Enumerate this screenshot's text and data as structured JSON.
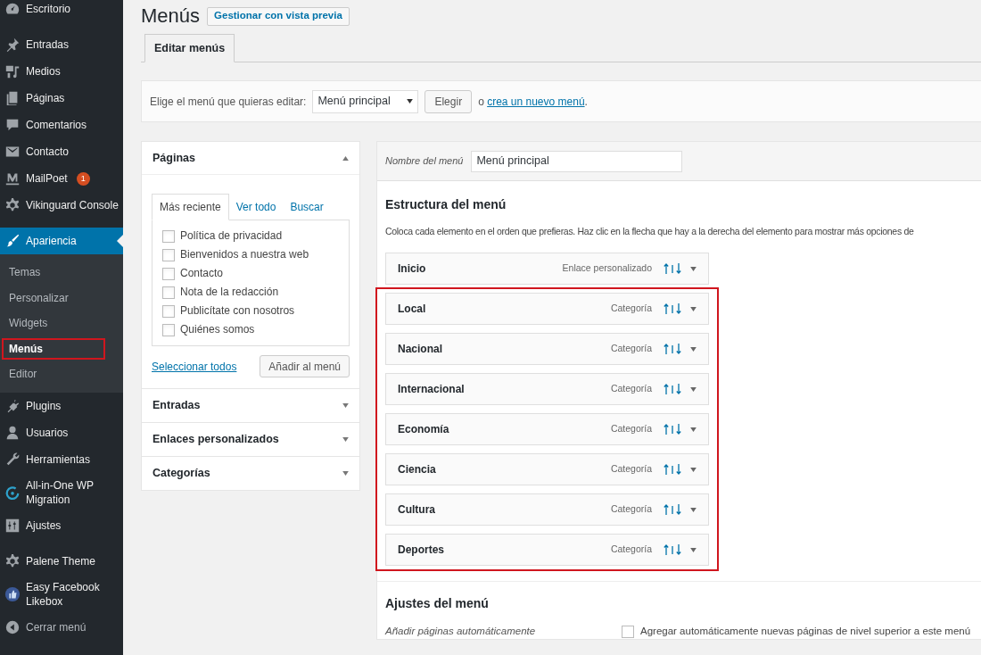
{
  "sidebar": {
    "groups": [
      [
        {
          "label": "Escritorio",
          "selected": false
        }
      ],
      [
        {
          "label": "Entradas",
          "selected": false
        },
        {
          "label": "Medios",
          "selected": false
        },
        {
          "label": "Páginas",
          "selected": false
        },
        {
          "label": "Comentarios",
          "selected": false
        },
        {
          "label": "Contacto",
          "selected": false
        },
        {
          "label": "MailPoet",
          "badge": "1",
          "selected": false
        },
        {
          "label": "Vikinguard Console",
          "selected": false
        }
      ],
      [
        {
          "label": "Apariencia",
          "selected": true,
          "children": [
            {
              "label": "Temas",
              "selected": false
            },
            {
              "label": "Personalizar",
              "selected": false
            },
            {
              "label": "Widgets",
              "selected": false
            },
            {
              "label": "Menús",
              "selected": true
            },
            {
              "label": "Editor",
              "selected": false
            }
          ]
        },
        {
          "label": "Plugins",
          "selected": false
        },
        {
          "label": "Usuarios",
          "selected": false
        },
        {
          "label": "Herramientas",
          "selected": false
        },
        {
          "label": "All-in-One WP Migration",
          "selected": false
        },
        {
          "label": "Ajustes",
          "selected": false
        }
      ],
      [
        {
          "label": "Palene Theme",
          "selected": false
        },
        {
          "label": "Easy Facebook Likebox",
          "selected": false
        },
        {
          "label": "Cerrar menú",
          "kind": "collapse",
          "selected": false
        }
      ]
    ]
  },
  "page": {
    "title": "Menús",
    "action": "Gestionar con vista previa"
  },
  "tabs": [
    {
      "label": "Editar menús",
      "selected": true
    }
  ],
  "menu_select": {
    "label": "Elige el menú que quieras editar:",
    "value": "Menú principal",
    "button": "Elegir",
    "prefix": "o",
    "link": "crea un nuevo menú",
    "suffix": "."
  },
  "panels": [
    {
      "title": "Páginas",
      "expanded": true,
      "tabs": [
        {
          "label": "Más reciente",
          "selected": true
        },
        {
          "label": "Ver todo",
          "selected": false
        },
        {
          "label": "Buscar",
          "selected": false
        }
      ],
      "items": [
        {
          "label": "Política de privacidad",
          "checked": false
        },
        {
          "label": "Bienvenidos a nuestra web",
          "checked": false
        },
        {
          "label": "Contacto",
          "checked": false
        },
        {
          "label": "Nota de la redacción",
          "checked": false
        },
        {
          "label": "Publicítate con nosotros",
          "checked": false
        },
        {
          "label": "Quiénes somos",
          "checked": false
        }
      ],
      "select_all": "Seleccionar todos",
      "add_button": "Añadir al menú"
    },
    {
      "title": "Entradas",
      "expanded": false
    },
    {
      "title": "Enlaces personalizados",
      "expanded": false
    },
    {
      "title": "Categorías",
      "expanded": false
    }
  ],
  "editor": {
    "name_label": "Nombre del menú",
    "name_value": "Menú principal",
    "structure_title": "Estructura del menú",
    "instructions": "Coloca cada elemento en el orden que prefieras. Haz clic en la flecha que hay a la derecha del elemento para mostrar más opciones de",
    "item_groups": [
      {
        "items": [
          {
            "title": "Inicio",
            "type": "Enlace personalizado"
          }
        ]
      },
      {
        "highlighted": true,
        "items": [
          {
            "title": "Local",
            "type": "Categoría"
          },
          {
            "title": "Nacional",
            "type": "Categoría"
          },
          {
            "title": "Internacional",
            "type": "Categoría"
          },
          {
            "title": "Economía",
            "type": "Categoría"
          },
          {
            "title": "Ciencia",
            "type": "Categoría"
          },
          {
            "title": "Cultura",
            "type": "Categoría"
          },
          {
            "title": "Deportes",
            "type": "Categoría"
          }
        ]
      }
    ],
    "settings_title": "Ajustes del menú",
    "settings": [
      {
        "label": "Añadir páginas automáticamente",
        "option": "Agregar automáticamente nuevas páginas de nivel superior a este menú",
        "checked": false
      }
    ]
  }
}
